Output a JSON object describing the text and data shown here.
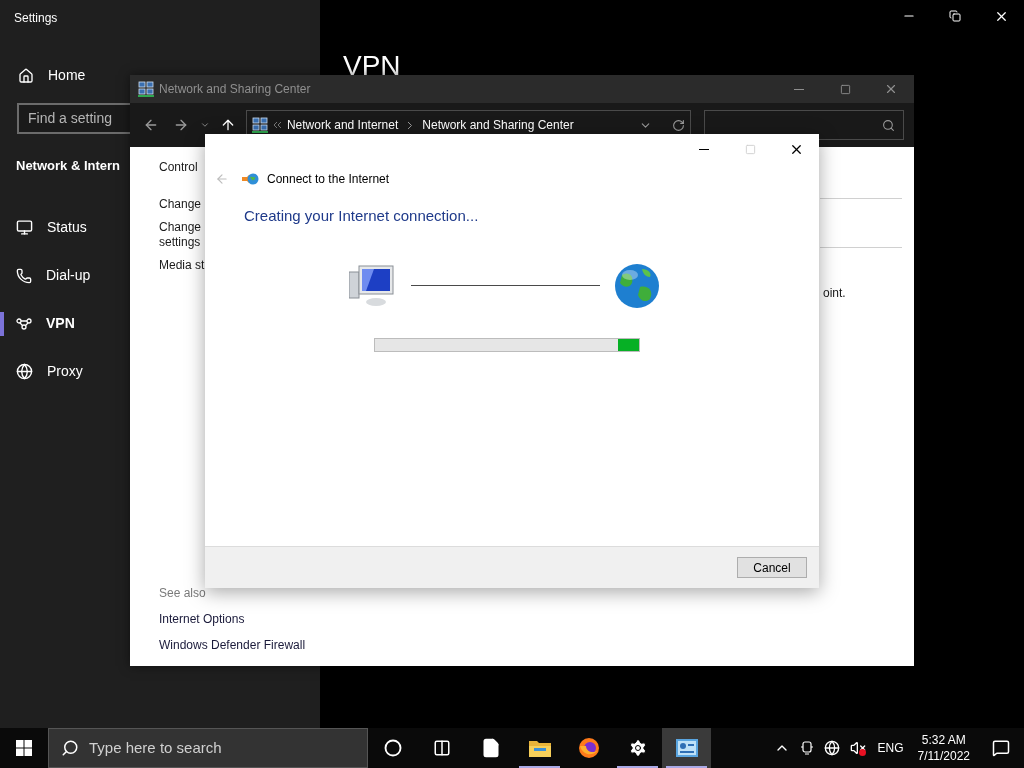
{
  "settings_window": {
    "title": "Settings",
    "home": "Home",
    "search": {
      "placeholder": "Find a setting"
    },
    "section": "Network & Intern",
    "page_title": "VPN",
    "nav": [
      {
        "label": "Status",
        "kind": "status",
        "selected": false
      },
      {
        "label": "Dial-up",
        "kind": "dialup",
        "selected": false
      },
      {
        "label": "VPN",
        "kind": "vpn",
        "selected": true
      },
      {
        "label": "Proxy",
        "kind": "proxy",
        "selected": false
      }
    ]
  },
  "network_window": {
    "title": "Network and Sharing Center",
    "breadcrumb": [
      "Network and Internet",
      "Network and Sharing Center"
    ],
    "left_links": [
      "Control",
      "Change",
      "Change\nsettings",
      "Media st"
    ],
    "right_text": "oint.",
    "see_also": {
      "heading": "See also",
      "links": [
        "Internet Options",
        "Windows Defender Firewall"
      ]
    }
  },
  "dialog": {
    "title": "Connect to the Internet",
    "heading": "Creating your Internet connection...",
    "progress": {
      "level": 0.08
    },
    "button": "Cancel"
  },
  "taskbar": {
    "search_placeholder": "Type here to search",
    "apps": [
      {
        "kind": "cortana",
        "running": false,
        "selected": false
      },
      {
        "kind": "taskview",
        "running": false,
        "selected": false
      },
      {
        "kind": "file",
        "running": false,
        "selected": false
      },
      {
        "kind": "folder",
        "running": true,
        "selected": false
      },
      {
        "kind": "firefox",
        "running": false,
        "selected": false
      },
      {
        "kind": "settings",
        "running": true,
        "selected": false
      },
      {
        "kind": "controlpanel",
        "running": true,
        "selected": true
      }
    ],
    "language": "ENG",
    "time": "5:32 AM",
    "date": "7/11/2022"
  }
}
